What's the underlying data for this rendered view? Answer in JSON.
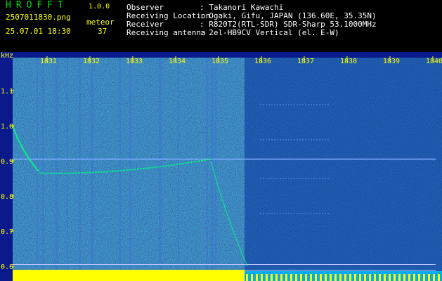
{
  "header": {
    "brand": "HROFFT",
    "version": "1.0.0",
    "filename": "2507011830.png",
    "datetime": "25.07.01 18:30",
    "meteor_label": "meteor",
    "meteor_count": "37"
  },
  "info": [
    {
      "key": "Observer",
      "value": ": Takanori Kawachi"
    },
    {
      "key": "Receiving Location",
      "value": ": Ogaki, Gifu, JAPAN (136.60E, 35.35N)"
    },
    {
      "key": "Receiver",
      "value": ": R820T2(RTL-SDR) SDR-Sharp 53.1000MHz"
    },
    {
      "key": "Receiving antenna",
      "value": ": 2el-HB9CV Vertical (el. E-W)"
    }
  ],
  "spectrogram": {
    "y_unit": "kHz",
    "y_ticks": [
      "1.1",
      "1.0",
      "0.9",
      "0.8",
      "0.7",
      "0.6"
    ],
    "time_ticks": [
      "1831",
      "1832",
      "1833",
      "1834",
      "1835",
      "1836",
      "1837",
      "1838",
      "1839",
      "1840"
    ],
    "colors": {
      "background": "#1020a0",
      "tick_label": "#ffff00",
      "axis_label": "#ffffff",
      "echo": "#00ff80"
    }
  }
}
